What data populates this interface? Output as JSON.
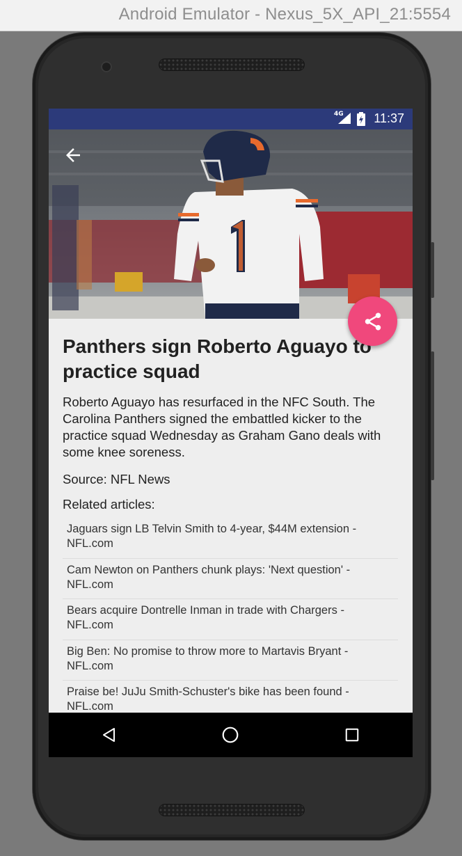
{
  "window": {
    "title": "Android Emulator - Nexus_5X_API_21:5554"
  },
  "status_bar": {
    "network": "4G",
    "time": "11:37"
  },
  "article": {
    "headline": "Panthers sign Roberto Aguayo to practice squad",
    "summary": "Roberto Aguayo has resurfaced in the NFC South. The Carolina Panthers signed the embattled kicker to the practice squad Wednesday as Graham Gano deals with some knee soreness.",
    "source": "Source: NFL News"
  },
  "related": {
    "title": "Related articles:",
    "items": [
      "Jaguars sign LB Telvin Smith to 4-year, $44M extension - NFL.com",
      "Cam Newton on Panthers chunk plays: 'Next question' - NFL.com",
      "Bears acquire Dontrelle Inman in trade with Chargers - NFL.com",
      "Big Ben: No promise to throw more to Martavis Bryant - NFL.com",
      "Praise be! JuJu Smith-Schuster's bike has been found - NFL.com"
    ]
  },
  "icons": {
    "back": "arrow-back-icon",
    "share": "share-icon",
    "nav_back": "triangle-back-icon",
    "nav_home": "circle-home-icon",
    "nav_recents": "square-recents-icon"
  },
  "colors": {
    "status_bar": "#2c3a7a",
    "fab": "#f0487c",
    "screen_bg": "#eeeeee"
  }
}
